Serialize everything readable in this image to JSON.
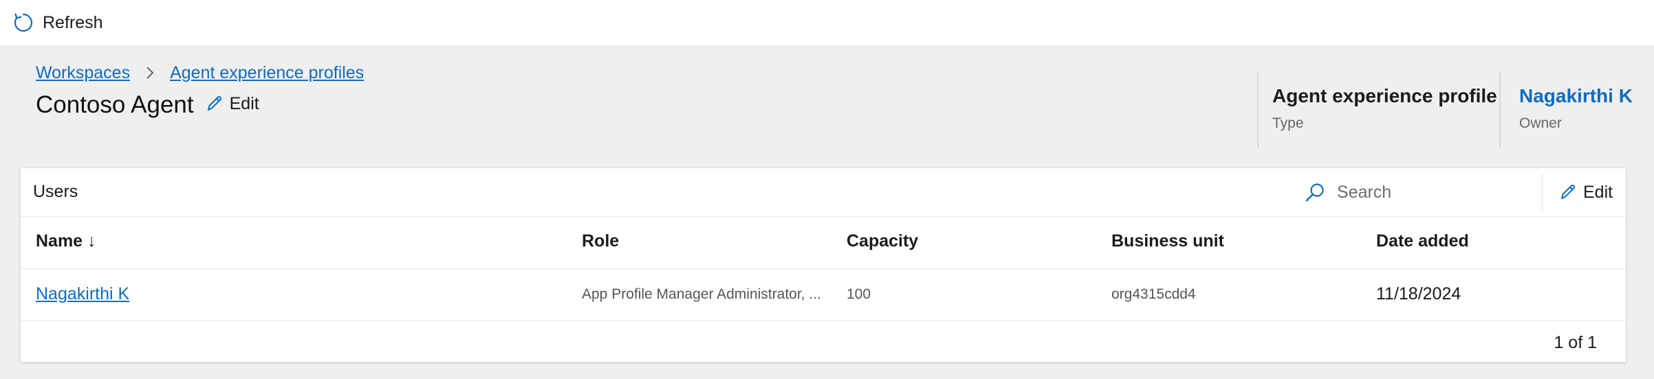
{
  "toolbar": {
    "refresh_label": "Refresh",
    "refresh_icon": "refresh-icon"
  },
  "breadcrumb": {
    "items": [
      "Workspaces",
      "Agent experience profiles"
    ],
    "separator_icon": "chevron-right-icon"
  },
  "header": {
    "title": "Contoso Agent",
    "edit_label": "Edit",
    "type": {
      "value": "Agent experience profile",
      "label": "Type"
    },
    "owner": {
      "value": "Nagakirthi K",
      "label": "Owner"
    }
  },
  "users": {
    "title": "Users",
    "search": {
      "placeholder": "Search"
    },
    "edit_label": "Edit",
    "columns": [
      "Name ↓",
      "Role",
      "Capacity",
      "Business unit",
      "Date added"
    ],
    "rows": [
      {
        "name": "Nagakirthi K",
        "role": "App Profile Manager Administrator, ...",
        "capacity": "100",
        "business_unit": "org4315cdd4",
        "date_added": "11/18/2024"
      }
    ],
    "pager": "1 of 1"
  },
  "colors": {
    "accent": "#0f6cbd",
    "background": "#efefef",
    "surface": "#ffffff"
  }
}
